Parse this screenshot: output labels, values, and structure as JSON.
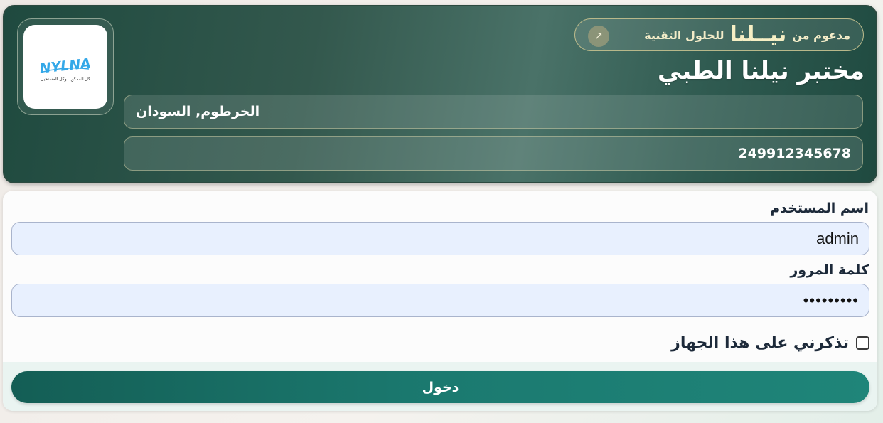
{
  "header": {
    "badge": {
      "prefix": "مدعوم من",
      "brand": "نيــلنا",
      "suffix": "للحلول التقنية",
      "arrow_icon": "external-link-icon"
    },
    "lab_name": "مختبر نيلنا الطبي",
    "location": "الخرطوم, السودان",
    "phone": "249912345678",
    "logo": {
      "wordmark": "NYLNA",
      "tagline": "كل الممكن.. وكل المستحيل"
    }
  },
  "form": {
    "username_label": "اسم المستخدم",
    "username_value": "admin",
    "password_label": "كلمة المرور",
    "password_value": "•••••••••",
    "remember_label": "تذكرني على هذا الجهاز",
    "remember_checked": false,
    "submit_label": "دخول"
  },
  "colors": {
    "header_bg": "#33584d",
    "accent": "#1b7a70",
    "input_bg": "#e8f0fe"
  }
}
